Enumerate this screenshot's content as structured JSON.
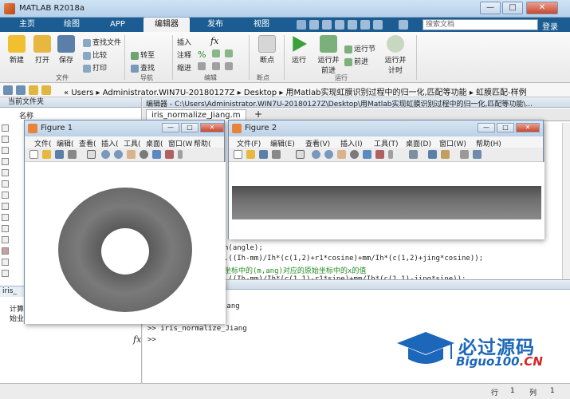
{
  "app": {
    "title": "MATLAB R2018a",
    "window_buttons": {
      "minimize": "—",
      "maximize": "□",
      "close": "✕"
    }
  },
  "tabs": [
    "主页",
    "绘图",
    "APP",
    "编辑器",
    "发布",
    "视图"
  ],
  "active_tab": "编辑器",
  "search": {
    "placeholder": "搜索文档"
  },
  "login_label": "登录",
  "ribbon": {
    "file": {
      "new": "新建",
      "open": "打开",
      "save": "保存",
      "find_files": "查找文件",
      "compare": "比较",
      "print": "打印",
      "group": "文件"
    },
    "navigate": {
      "goto": "转至",
      "find": "查找",
      "group": "导航"
    },
    "edit": {
      "insert": "插入",
      "comment": "注释",
      "indent": "缩进",
      "group": "编辑",
      "fx": "fx"
    },
    "breakpoints": {
      "label": "断点",
      "group": "断点"
    },
    "run": {
      "run": "运行",
      "run_advance": "运行并\n前进",
      "run_section": "运行节",
      "advance": "前进",
      "run_time": "运行并\n计时",
      "group": "运行"
    }
  },
  "address": {
    "path_parts": [
      "«",
      "Users",
      "Administrator.WIN7U-20180127Z",
      "Desktop",
      "用Matlab实现虹膜识别过程中的归一化,匹配等功能",
      "虹膜匹配-样例"
    ]
  },
  "left_panel": {
    "title": "当前文件夹",
    "column": "名称",
    "details_label": "iris_",
    "details_text_1": "计算",
    "details_text_2": "始业"
  },
  "editor": {
    "header": "编辑器 - C:\\Users\\Administrator.WIN7U-20180127Z\\Desktop\\用Matlab实现虹膜识别过程中的归一化,匹配等功能\\...",
    "tab": "iris_normalize_Jiang.m",
    "plus": "+",
    "code_lines": [
      "n(angle);",
      ".((Ih-mm)/Ih*(c(1,2)+r1*cosine)+mm/Ih*(c(1,2)+jing*cosine));",
      "坐标中的(m,ang)对应的原始坐标中的x的值",
      ".((Ih-mm)/Ih*(c(1,1)-r1*sine)+mm/Ih*(c(1,1)-jing*sine));"
    ]
  },
  "command_window": {
    "lines": [
      "iang",
      "",
      ">> iris_normalize_Jiang",
      ">>"
    ],
    "fx": "fx"
  },
  "status": {
    "row_label": "行",
    "row": "1",
    "col_label": "列",
    "col": "1"
  },
  "figure1": {
    "title": "Figure 1",
    "menu": [
      "文件(",
      "编辑(",
      "查看(",
      "插入(",
      "工具(",
      "桌面(",
      "窗口(W",
      "帮助("
    ]
  },
  "figure2": {
    "title": "Figure 2",
    "menu": [
      "文件(F)",
      "编辑(E)",
      "查看(V)",
      "插入(I)",
      "工具(T)",
      "桌面(D)",
      "窗口(W)",
      "帮助(H)"
    ]
  },
  "watermark": {
    "cn": "必过源码",
    "en_main": "Biguo100",
    "en_suffix": ".CN"
  },
  "colors": {
    "tab_bar": "#1b5d93",
    "accent": "#1c67b9",
    "watermark_red": "#d2262b"
  }
}
